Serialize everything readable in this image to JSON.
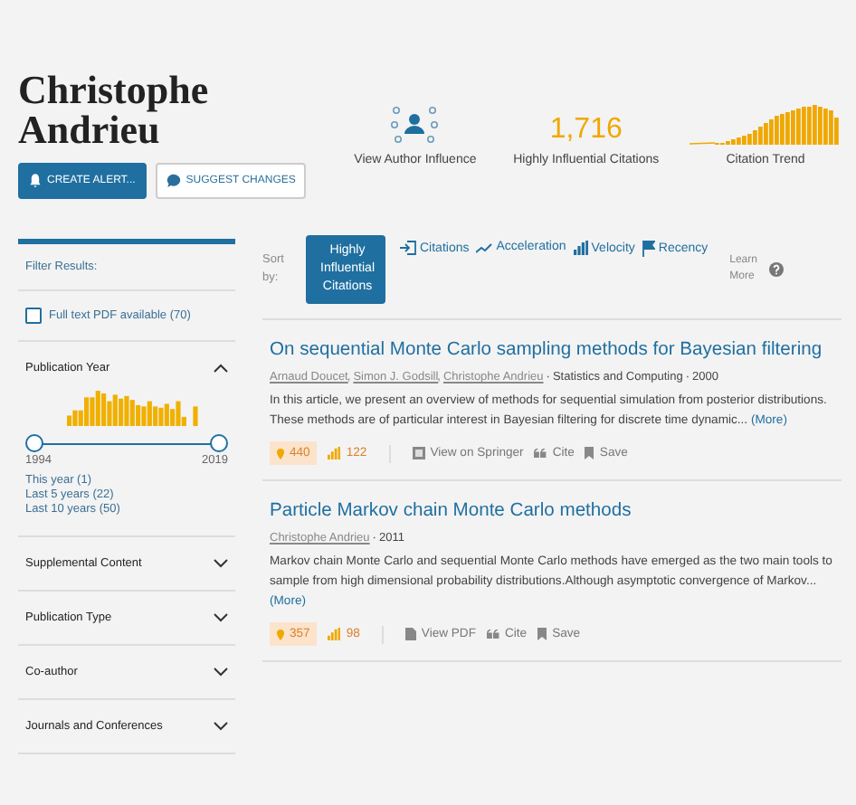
{
  "author": {
    "name": "Christophe Andrieu"
  },
  "header_buttons": [
    {
      "kind": "primary",
      "label": "CREATE ALERT..."
    },
    {
      "kind": "secondary",
      "label": "SUGGEST CHANGES"
    }
  ],
  "stats": {
    "influence_label": "View Author Influence",
    "highly_influential_count": "1,716",
    "highly_influential_label": "Highly Influential Citations",
    "trend_label": "Citation Trend"
  },
  "sidebar": {
    "title": "Filter Results:",
    "pdf_filter": {
      "label": "Full text PDF available (70)",
      "checked": false
    },
    "sections": [
      {
        "label": "Publication Year",
        "expanded": true,
        "level": 1,
        "range_start": "1994",
        "range_end": "2019",
        "links": [
          "This year (1)",
          "Last 5 years (22)",
          "Last 10 years (50)"
        ]
      },
      {
        "label": "Supplemental Content",
        "expanded": false
      },
      {
        "label": "Publication Type",
        "expanded": false
      },
      {
        "label": "Co-author",
        "expanded": false
      },
      {
        "label": "Journals and Conferences",
        "expanded": false
      }
    ]
  },
  "sort": {
    "label": "Sort by:",
    "options": [
      {
        "kind": "influential",
        "label": "Highly Influential Citations",
        "selected": true
      },
      {
        "kind": "citations",
        "label": "Citations",
        "selected": false
      },
      {
        "kind": "acceleration",
        "label": "Acceleration",
        "selected": false
      },
      {
        "kind": "velocity",
        "label": "Velocity",
        "selected": false
      },
      {
        "kind": "recency",
        "label": "Recency",
        "selected": false
      }
    ],
    "learn_more": "Learn More"
  },
  "papers": [
    {
      "title": "On sequential Monte Carlo sampling methods for Bayesian filtering",
      "authors": [
        "Arnaud Doucet",
        "Simon J. Godsill",
        "Christophe Andrieu"
      ],
      "author_separator": ",",
      "meta_separator": "·",
      "venue": "Statistics and Computing",
      "year": "2000",
      "abstract": "In this article, we present an overview of methods for sequential simulation from posterior distributions. These methods are of particular interest in Bayesian filtering for discrete time dynamic...",
      "more": "(More)",
      "influential_count": "440",
      "citation_count": "122",
      "link": {
        "kind": "external",
        "label": "View on Springer"
      },
      "cite": "Cite",
      "save": "Save"
    },
    {
      "title": "Particle Markov chain Monte Carlo methods",
      "authors": [
        "Christophe Andrieu"
      ],
      "meta_separator": "·",
      "year": "2011",
      "abstract": "Markov chain Monte Carlo and sequential Monte Carlo methods have emerged as the two main tools to sample from high dimensional probability distributions.Although asymptotic convergence of Markov...",
      "more": "(More)",
      "influential_count": "357",
      "citation_count": "98",
      "link": {
        "kind": "pdf",
        "label": "View PDF"
      },
      "cite": "Cite",
      "save": "Save"
    }
  ]
}
